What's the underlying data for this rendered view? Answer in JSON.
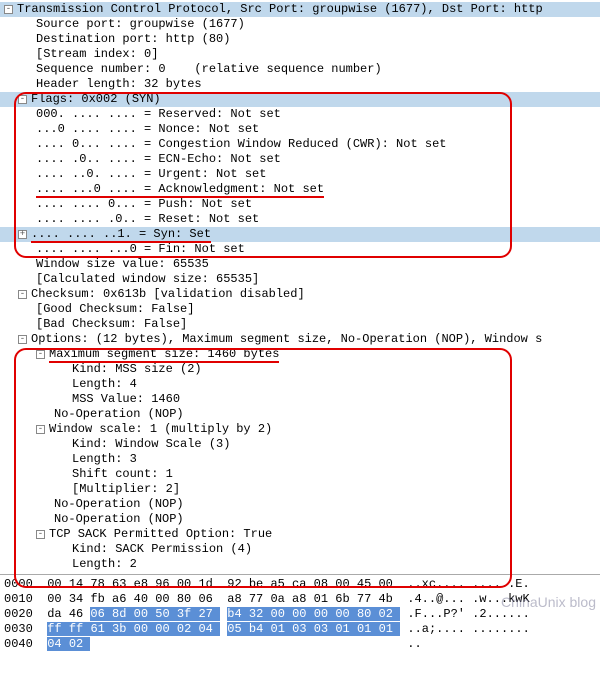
{
  "header": {
    "title": "Transmission Control Protocol, Src Port: groupwise (1677), Dst Port: http"
  },
  "tree": {
    "src_port": "Source port: groupwise (1677)",
    "dst_port": "Destination port: http (80)",
    "stream_index": "[Stream index: 0]",
    "seq_num": "Sequence number: 0    (relative sequence number)",
    "header_len": "Header length: 32 bytes",
    "flags_header": "Flags: 0x002 (SYN)",
    "flags": {
      "reserved": "000. .... .... = Reserved: Not set",
      "nonce": "...0 .... .... = Nonce: Not set",
      "cwr": ".... 0... .... = Congestion Window Reduced (CWR): Not set",
      "ecn": ".... .0.. .... = ECN-Echo: Not set",
      "urgent": ".... ..0. .... = Urgent: Not set",
      "ack": ".... ...0 .... = Acknowledgment: Not set",
      "push": ".... .... 0... = Push: Not set",
      "reset": ".... .... .0.. = Reset: Not set",
      "syn": ".... .... ..1. = Syn: Set",
      "fin": ".... .... ...0 = Fin: Not set"
    },
    "win_size": "Window size value: 65535",
    "calc_win": "[Calculated window size: 65535]",
    "checksum_header": "Checksum: 0x613b [validation disabled]",
    "good_cksum": "[Good Checksum: False]",
    "bad_cksum": "[Bad Checksum: False]",
    "options_header": "Options: (12 bytes), Maximum segment size, No-Operation (NOP), Window s",
    "mss_header": "Maximum segment size: 1460 bytes",
    "mss": {
      "kind": "Kind: MSS size (2)",
      "len": "Length: 4",
      "val": "MSS Value: 1460"
    },
    "nop1": "No-Operation (NOP)",
    "ws_header": "Window scale: 1 (multiply by 2)",
    "ws": {
      "kind": "Kind: Window Scale (3)",
      "len": "Length: 3",
      "shift": "Shift count: 1",
      "mult": "[Multiplier: 2]"
    },
    "nop2": "No-Operation (NOP)",
    "nop3": "No-Operation (NOP)",
    "sack_header": "TCP SACK Permitted Option: True",
    "sack": {
      "kind": "Kind: SACK Permission (4)",
      "len": "Length: 2"
    }
  },
  "hex": {
    "rows": [
      {
        "offset": "0000",
        "bytes": "00 14 78 63 e8 96 00 1d  92 be a5 ca 08 00 45 00",
        "sel_start": -1,
        "sel_end": -1,
        "ascii": "..xc.... ......E."
      },
      {
        "offset": "0010",
        "bytes": "00 34 fb a6 40 00 80 06  a8 77 0a a8 01 6b 77 4b",
        "sel_start": -1,
        "sel_end": -1,
        "ascii": ".4..@... .w...kwK"
      },
      {
        "offset": "0020",
        "bytes": "da 46 06 8d 00 50 3f 27  b4 32 00 00 00 00 80 02",
        "sel_start": 2,
        "sel_end": 16,
        "ascii": ".F...P?' .2......"
      },
      {
        "offset": "0030",
        "bytes": "ff ff 61 3b 00 00 02 04  05 b4 01 03 03 01 01 01",
        "sel_start": 0,
        "sel_end": 16,
        "ascii": "..a;.... ........"
      },
      {
        "offset": "0040",
        "bytes": "04 02",
        "sel_start": 0,
        "sel_end": 2,
        "ascii": ".."
      }
    ]
  },
  "watermark": "ChinaUnix blog"
}
